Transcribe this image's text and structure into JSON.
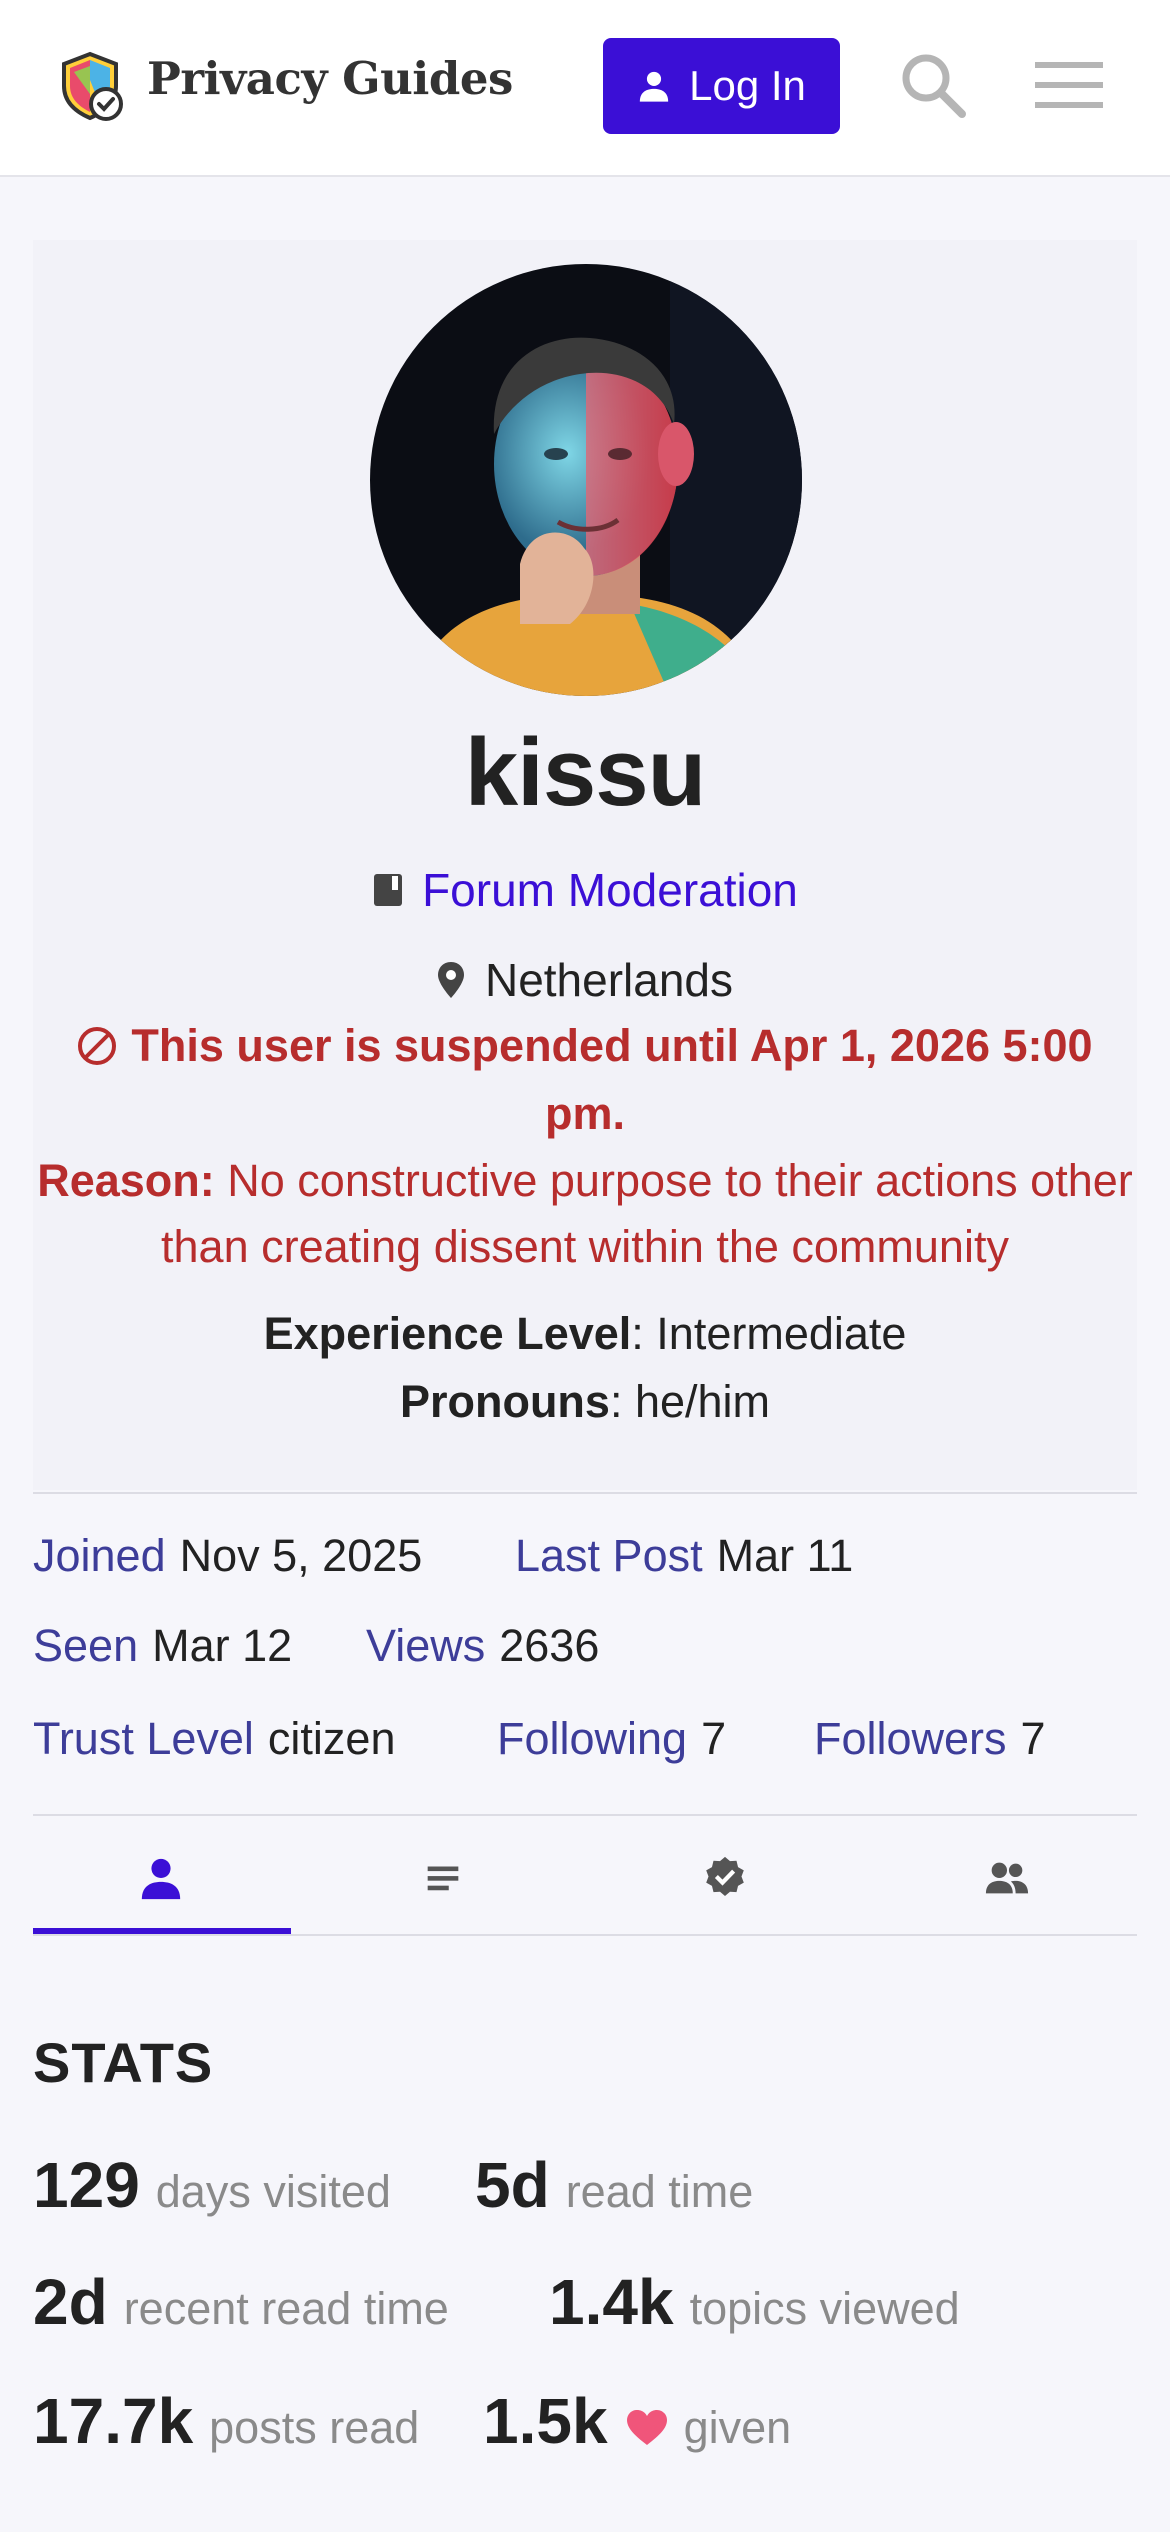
{
  "header": {
    "logo_text": "Privacy Guides",
    "login_label": "Log In",
    "accent_color": "#3b0fd6"
  },
  "profile": {
    "username": "kissu",
    "group": "Forum Moderation",
    "location": "Netherlands",
    "suspension": {
      "message": "This user is suspended until Apr 1, 2026 5:00 pm.",
      "reason_label": "Reason:",
      "reason_text": "No constructive purpose to their actions other than creating dissent within the community",
      "color": "#b72d2d"
    },
    "fields": [
      {
        "label": "Experience Level",
        "value": ": Intermediate"
      },
      {
        "label": "Pronouns",
        "value": ": he/him"
      }
    ]
  },
  "metadata": {
    "joined": {
      "label": "Joined",
      "value": "Nov 5, 2025"
    },
    "last_post": {
      "label": "Last Post",
      "value": "Mar 11"
    },
    "seen": {
      "label": "Seen",
      "value": "Mar 12"
    },
    "views": {
      "label": "Views",
      "value": "2636"
    },
    "trust_level": {
      "label": "Trust Level",
      "value": "citizen"
    },
    "following": {
      "label": "Following",
      "value": "7"
    },
    "followers": {
      "label": "Followers",
      "value": "7"
    }
  },
  "tabs": [
    {
      "icon": "user-icon",
      "active": true
    },
    {
      "icon": "activity-icon",
      "active": false
    },
    {
      "icon": "badge-icon",
      "active": false
    },
    {
      "icon": "group-icon",
      "active": false
    }
  ],
  "stats": {
    "heading": "STATS",
    "items": [
      {
        "value": "129",
        "label": "days visited"
      },
      {
        "value": "5d",
        "label": "read time"
      },
      {
        "value": "2d",
        "label": "recent read time"
      },
      {
        "value": "1.4k",
        "label": "topics viewed"
      },
      {
        "value": "17.7k",
        "label": "posts read"
      },
      {
        "value": "1.5k",
        "label": "given"
      }
    ]
  }
}
